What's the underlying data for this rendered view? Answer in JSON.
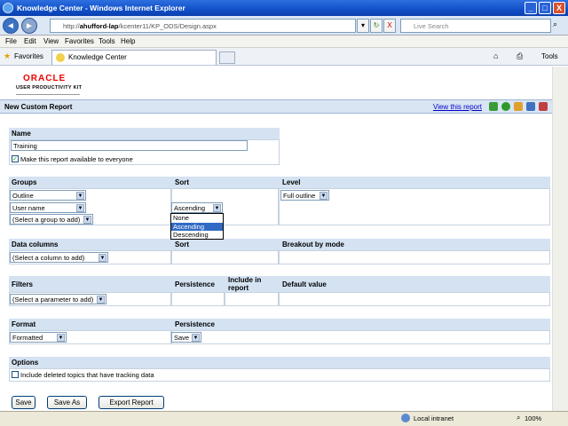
{
  "window": {
    "title": "Knowledge Center - Windows Internet Explorer",
    "min": "_",
    "max": "□",
    "close": "X"
  },
  "address": {
    "back": "◄",
    "fwd": "►",
    "url_pre": "http://",
    "url_host": "ahufford-lap",
    "url_rest": "/kcenter11/KP_ODS/Design.aspx",
    "refresh": "↻",
    "stop": "X",
    "search_placeholder": "Live Search"
  },
  "menu": [
    "File",
    "Edit",
    "View",
    "Favorites",
    "Tools",
    "Help"
  ],
  "favbar": {
    "favorites": "Favorites",
    "tab": "Knowledge Center",
    "tools": "Tools"
  },
  "logo": {
    "oracle": "ORACLE",
    "kit": "USER PRODUCTIVITY KIT"
  },
  "header": {
    "title": "New Custom Report",
    "link": "View this report"
  },
  "name": {
    "label": "Name",
    "value": "Training",
    "share": "Make this report available to everyone"
  },
  "groups": {
    "h_groups": "Groups",
    "h_sort": "Sort",
    "h_level": "Level",
    "g1": "Outline",
    "g2": "User name",
    "g3": "(Select a group to add)",
    "sort2": "Ascending",
    "level": "Full outline"
  },
  "dropdown": [
    "None",
    "Ascending",
    "Descending"
  ],
  "datacols": {
    "h1": "Data columns",
    "h2": "Sort",
    "h3": "Breakout by mode",
    "sel": "(Select a column to add)"
  },
  "filters": {
    "h1": "Filters",
    "h2": "Persistence",
    "h3a": "Include in",
    "h3b": "report",
    "h4": "Default value",
    "sel": "(Select a parameter to add)"
  },
  "format": {
    "h1": "Format",
    "h2": "Persistence",
    "f": "Formatted",
    "p": "Save"
  },
  "options": {
    "h": "Options",
    "deleted": "Include deleted topics that have tracking data"
  },
  "buttons": {
    "save": "Save",
    "save_as": "Save As",
    "export": "Export Report"
  },
  "status": {
    "zone": "Local intranet",
    "zoom": "100%"
  }
}
